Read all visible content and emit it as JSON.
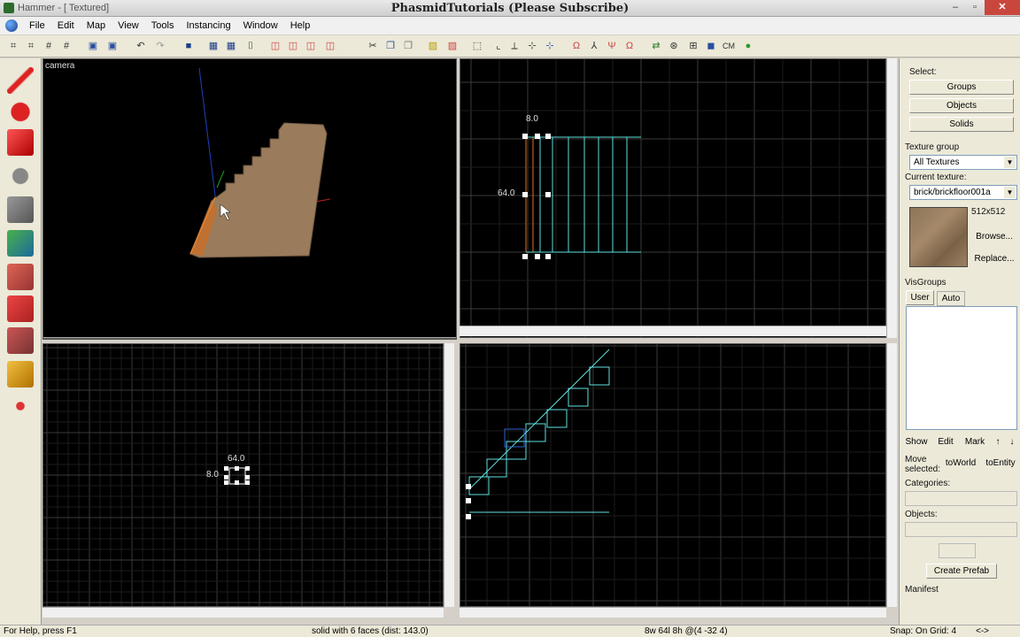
{
  "title_bar": {
    "app_label": "Hammer - [ Textured]",
    "window_title": "PhasmidTutorials (Please Subscribe)",
    "buttons": [
      "–",
      "▫",
      "✕"
    ]
  },
  "menu": [
    "File",
    "Edit",
    "Map",
    "View",
    "Tools",
    "Instancing",
    "Window",
    "Help"
  ],
  "viewports": {
    "camera_label": "camera",
    "top_right_labels": {
      "width": "8.0",
      "height": "64.0"
    },
    "bottom_left_labels": {
      "width": "64.0",
      "height": "8.0"
    }
  },
  "right_panel": {
    "select_label": "Select:",
    "select_buttons": [
      "Groups",
      "Objects",
      "Solids"
    ],
    "texture_group_label": "Texture group",
    "texture_group_value": "All Textures",
    "current_texture_label": "Current texture:",
    "current_texture_value": "brick/brickfloor001a",
    "texture_size": "512x512",
    "browse_label": "Browse...",
    "replace_label": "Replace...",
    "visgroups_label": "VisGroups",
    "vis_tabs": [
      "User",
      "Auto"
    ],
    "vis_buttons": [
      "Show",
      "Edit",
      "Mark"
    ],
    "move_selected_label": "Move selected:",
    "to_world_label": "toWorld",
    "to_entity_label": "toEntity",
    "categories_label": "Categories:",
    "objects_label": "Objects:",
    "create_prefab_label": "Create Prefab",
    "manifest_label": "Manifest"
  },
  "status_bar": {
    "help": "For Help, press F1",
    "selection": "solid with 6 faces  (dist: 143.0)",
    "dims": "8w 64l 8h @(4 -32 4)",
    "snap": "Snap: On Grid: 4",
    "extra": "<->"
  },
  "colors": {
    "viewport_bg": "#000000",
    "grid_major": "#3a3a3a",
    "grid_minor": "#1c1c1c",
    "selection": "#5fe0e0",
    "handle": "#ffffff",
    "brush_orange": "#e07020"
  }
}
